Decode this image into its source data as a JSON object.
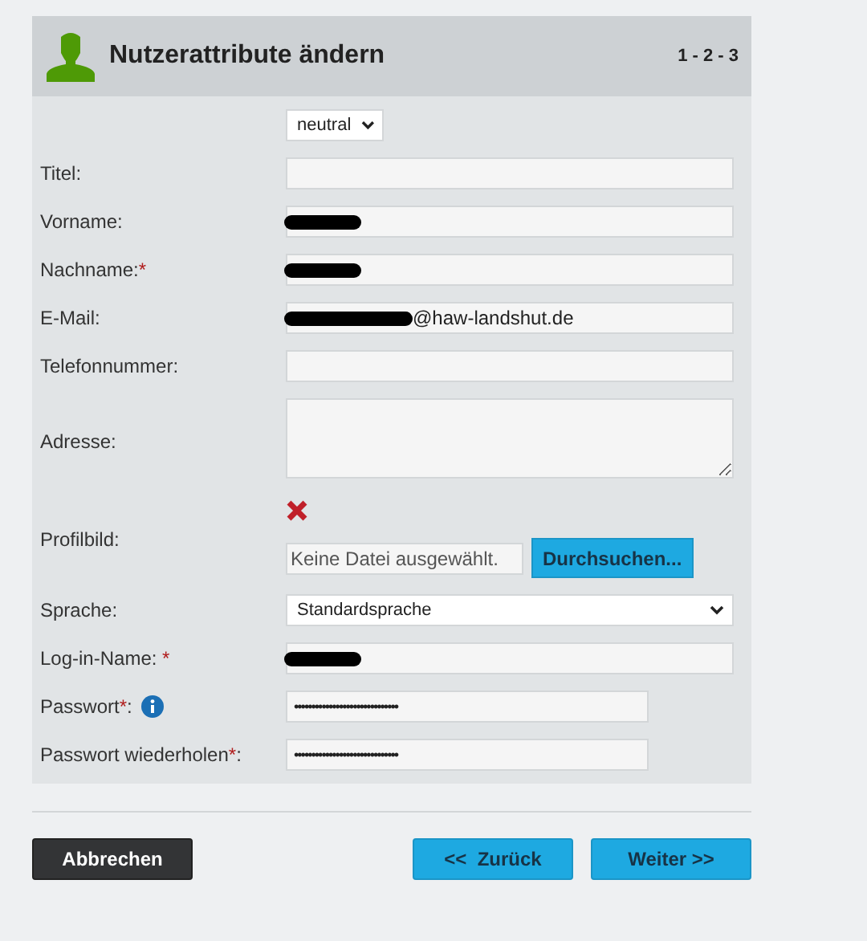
{
  "header": {
    "title": "Nutzerattribute ändern",
    "steps": "1 - 2 - 3"
  },
  "fields": [
    {
      "kind": "select",
      "value": "neutral",
      "wide": false
    },
    {
      "kind": "text",
      "label": [
        {
          "text": "Titel:",
          "kind": "plain"
        }
      ],
      "redacted": false
    },
    {
      "kind": "text",
      "label": [
        {
          "text": "Vorname:",
          "kind": "plain"
        }
      ],
      "redacted": true
    },
    {
      "kind": "text",
      "label": [
        {
          "text": "Nachname:",
          "kind": "plain"
        },
        {
          "text": "*",
          "kind": "required"
        }
      ],
      "redacted": true
    },
    {
      "kind": "text",
      "label": [
        {
          "text": "E-Mail:",
          "kind": "plain"
        }
      ],
      "value": "@haw-landshut.de",
      "redacted": true
    },
    {
      "kind": "text",
      "label": [
        {
          "text": "Telefonnummer:",
          "kind": "plain"
        }
      ],
      "redacted": false
    },
    {
      "kind": "textarea",
      "label": [
        {
          "text": "Adresse:",
          "kind": "plain"
        }
      ]
    },
    {
      "kind": "file",
      "label": [
        {
          "text": "Profilbild:",
          "kind": "plain"
        }
      ],
      "value": "Keine Datei ausgewählt.",
      "button": "Durchsuchen..."
    },
    {
      "kind": "select",
      "label": [
        {
          "text": "Sprache:",
          "kind": "plain"
        }
      ],
      "value": "Standardsprache",
      "wide": true
    },
    {
      "kind": "text",
      "label": [
        {
          "text": "Log-in-Name: ",
          "kind": "plain"
        },
        {
          "text": "*",
          "kind": "required"
        }
      ],
      "redacted": true
    },
    {
      "kind": "password",
      "label": [
        {
          "text": "Passwort",
          "kind": "plain"
        },
        {
          "text": "*",
          "kind": "required"
        },
        {
          "text": ":",
          "kind": "plain"
        }
      ],
      "value": "••••••••••••••••••••••••••••••",
      "info": true
    },
    {
      "kind": "password",
      "label": [
        {
          "text": "Passwort wiederholen",
          "kind": "plain"
        },
        {
          "text": "*",
          "kind": "required"
        },
        {
          "text": ":",
          "kind": "plain"
        }
      ],
      "value": "••••••••••••••••••••••••••••••",
      "info": false
    }
  ],
  "buttons": [
    {
      "label": "Abbrechen",
      "kind": "dark"
    },
    {
      "label": "<<  Zurück",
      "kind": "primary"
    },
    {
      "label": "Weiter >>",
      "kind": "primary"
    }
  ]
}
